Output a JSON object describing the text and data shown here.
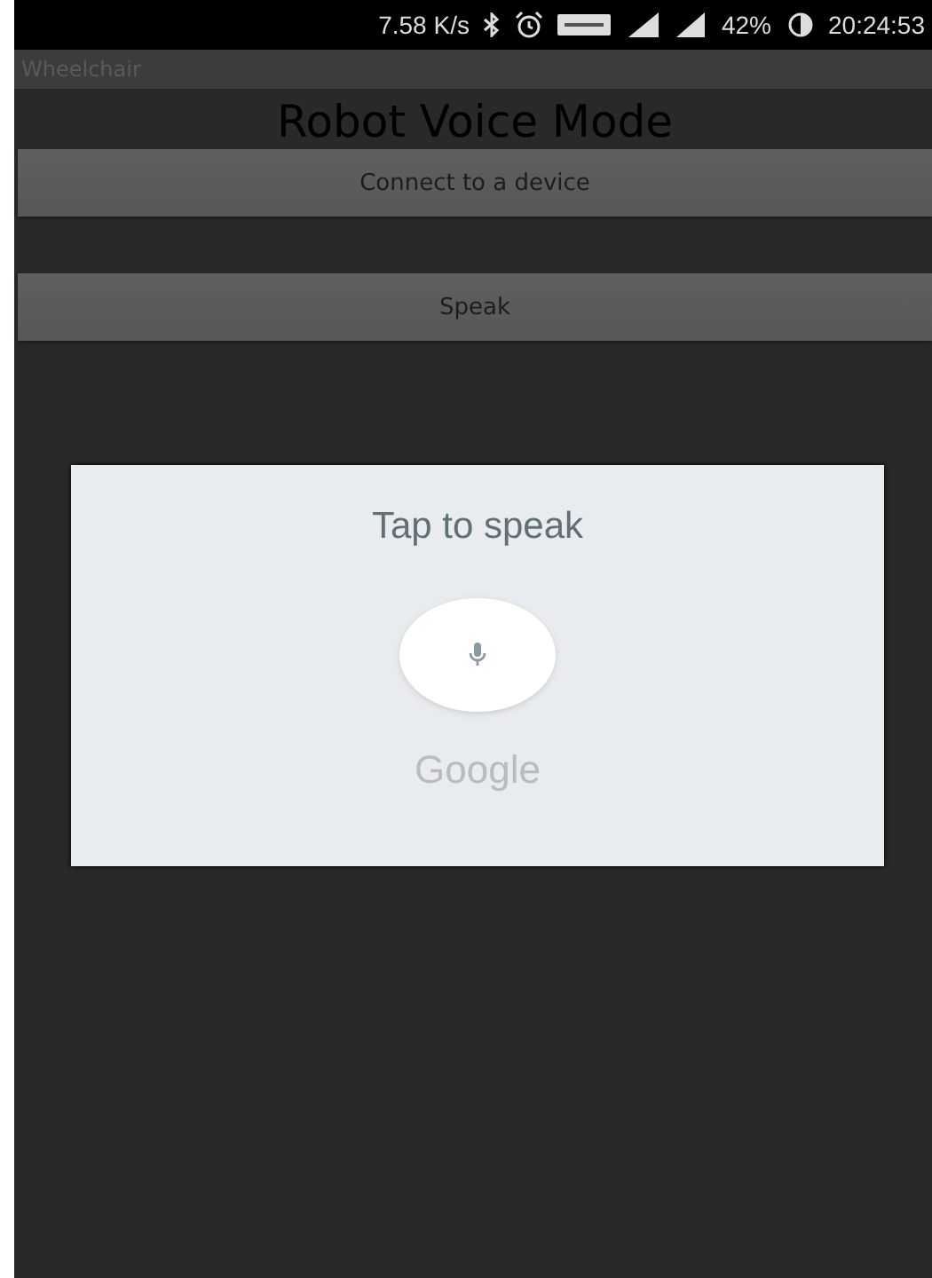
{
  "status_bar": {
    "speed": "7.58 K/s",
    "battery": "42%",
    "time": "20:24:53"
  },
  "app_bar": {
    "title": "Wheelchair"
  },
  "heading": "Robot Voice Mode",
  "buttons": [
    {
      "label": "Connect to a device"
    },
    {
      "label": "Speak"
    }
  ],
  "dialog": {
    "prompt": "Tap to speak",
    "brand": "Google"
  }
}
